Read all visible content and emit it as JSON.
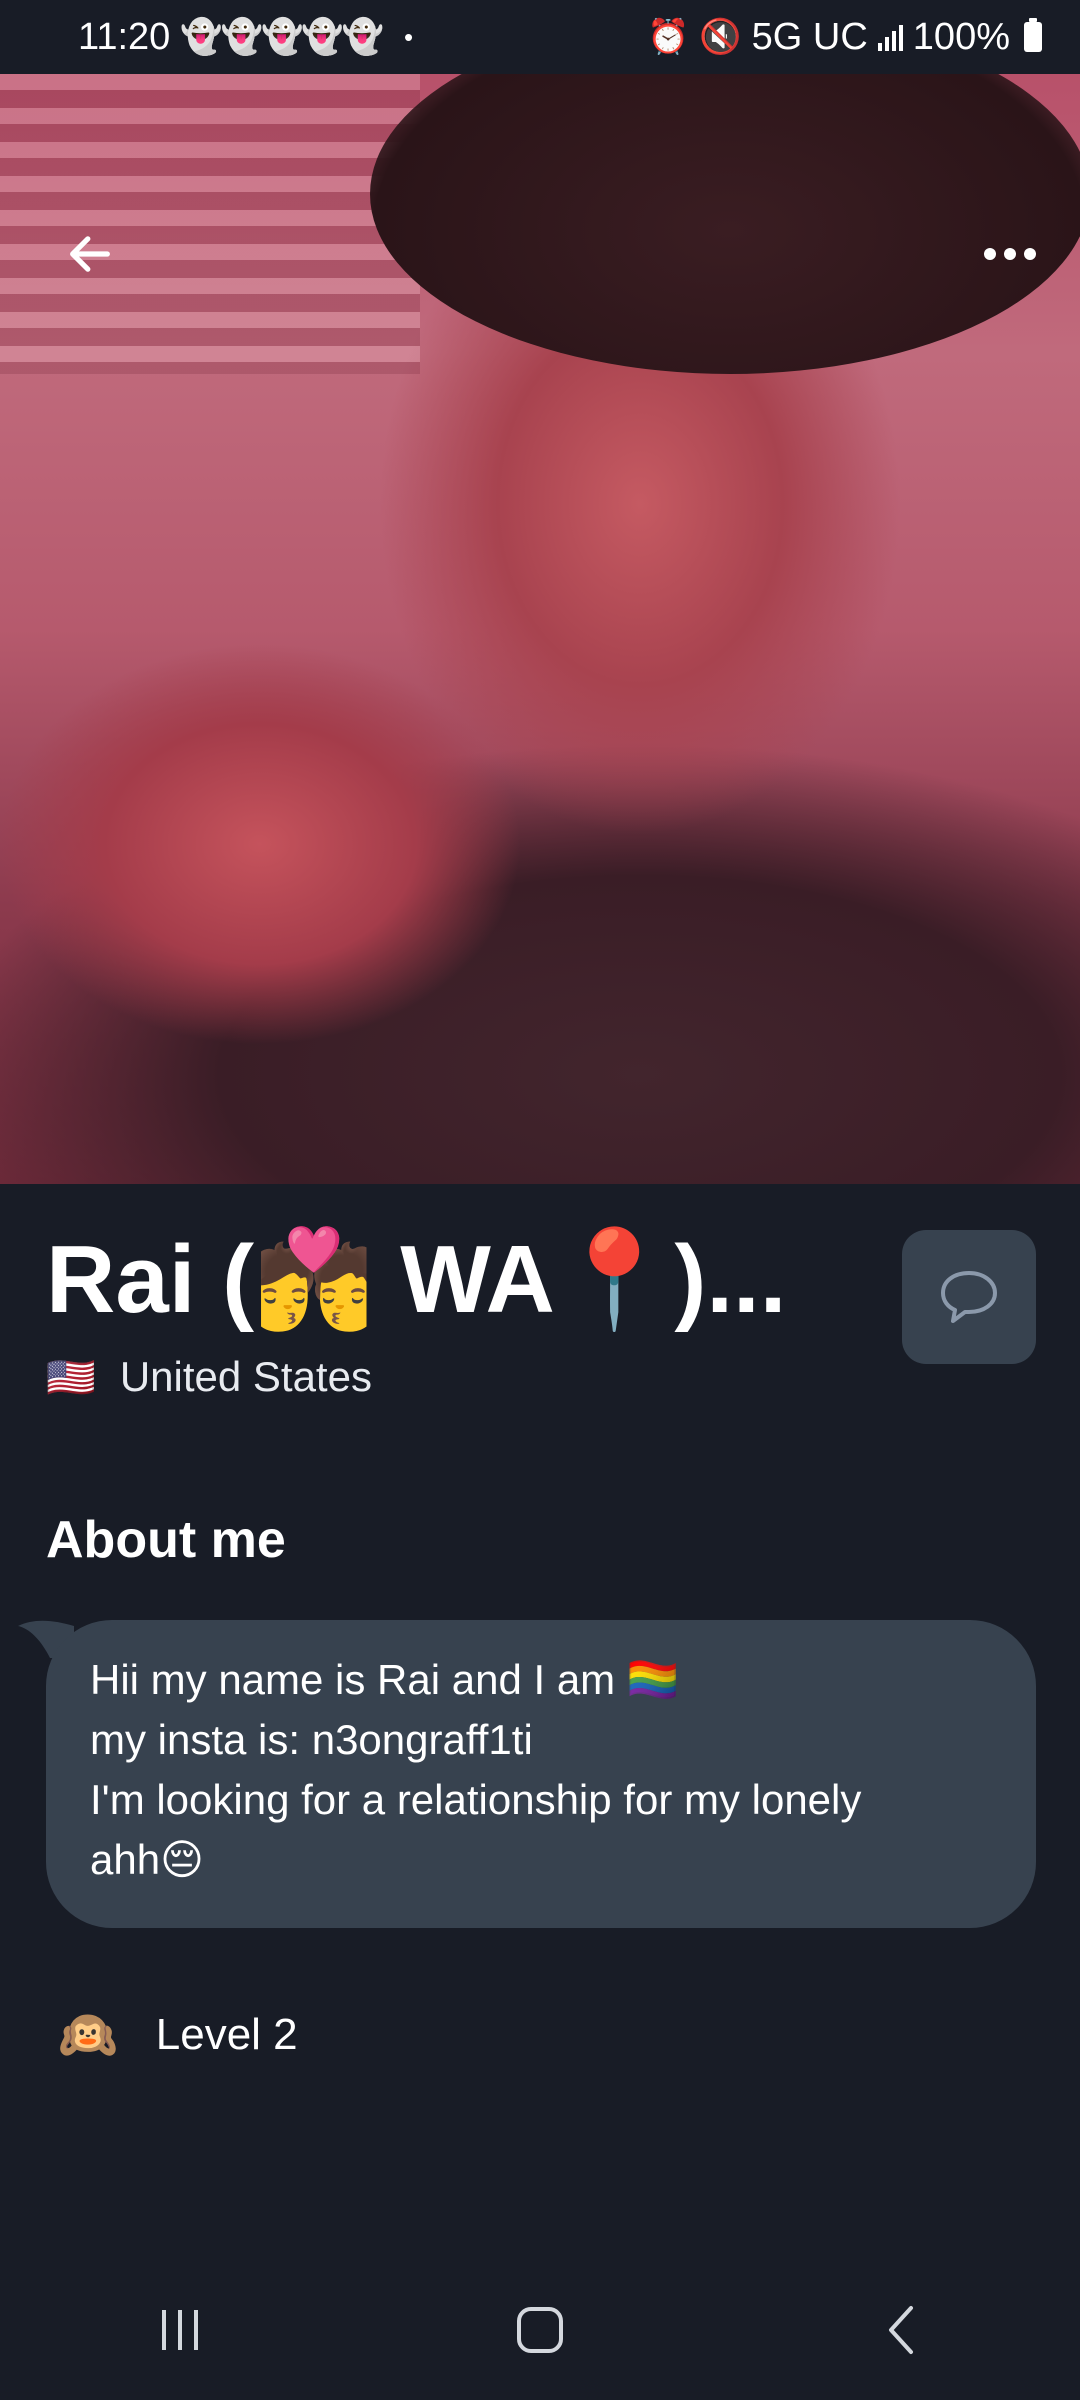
{
  "status_bar": {
    "time": "11:20",
    "snap_icons": "👻👻👻👻👻",
    "dot": "•",
    "network": "5G UC",
    "battery": "100%"
  },
  "profile": {
    "name": "Rai (💏 WA📍)...",
    "flag": "🇺🇸",
    "country": "United States"
  },
  "about": {
    "title": "About me",
    "lines": [
      "Hii my name is Rai and I am 🏳️‍🌈",
      "my insta is: n3ongraff1ti",
      "I'm looking for a relationship for my lonely",
      "ahh😔"
    ]
  },
  "level": {
    "icon": "🙉",
    "label": "Level 2"
  },
  "icons": {
    "back": "back-arrow-icon",
    "more": "more-options-icon",
    "message": "chat-bubble-icon",
    "nav_recents": "recents-icon",
    "nav_home": "home-icon",
    "nav_back": "nav-back-icon"
  }
}
